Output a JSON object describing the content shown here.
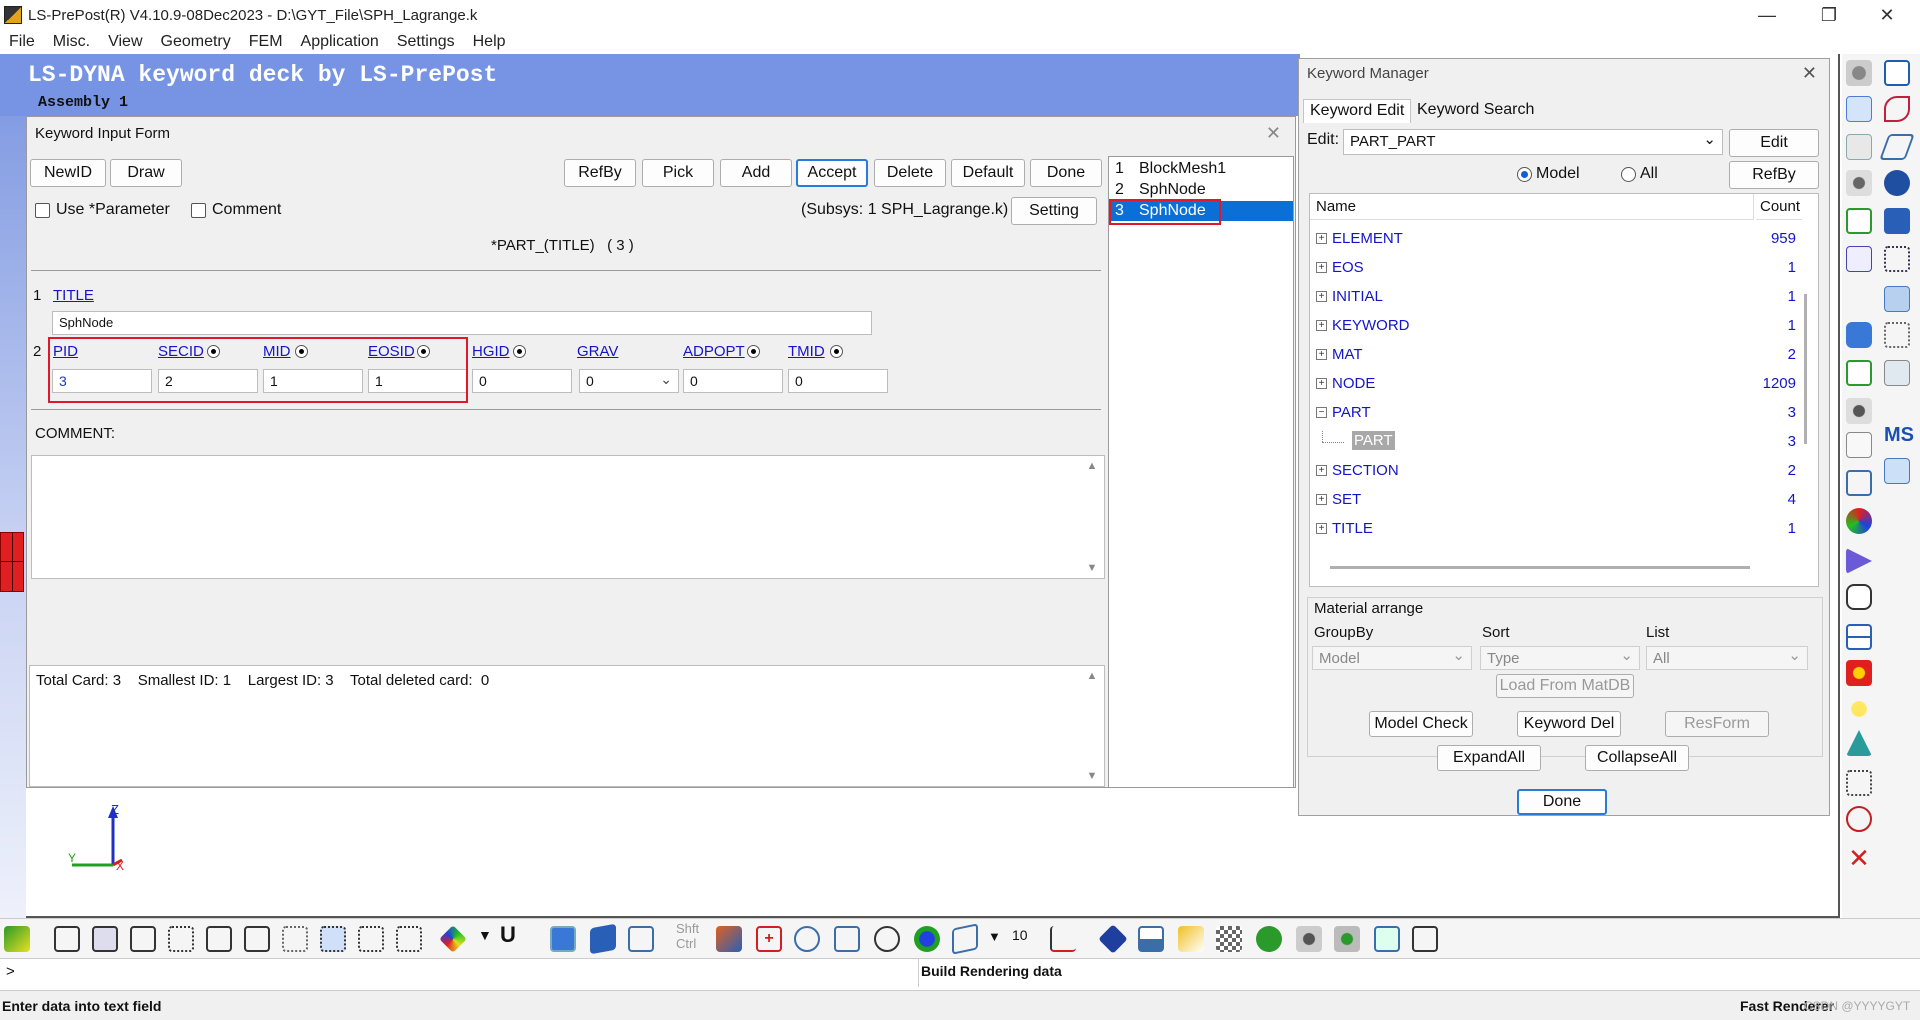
{
  "window": {
    "title": "LS-PrePost(R) V4.10.9-08Dec2023 - D:\\GYT_File\\SPH_Lagrange.k",
    "min": "—",
    "max": "❐",
    "close": "✕"
  },
  "menu": [
    "File",
    "Misc.",
    "View",
    "Geometry",
    "FEM",
    "Application",
    "Settings",
    "Help"
  ],
  "banner": {
    "title": "LS-DYNA keyword deck by LS-PrePost",
    "subtitle": "Assembly 1"
  },
  "kif": {
    "title": "Keyword Input Form",
    "close": "✕",
    "buttons": {
      "newid": "NewID",
      "draw": "Draw",
      "refby": "RefBy",
      "pick": "Pick",
      "add": "Add",
      "accept": "Accept",
      "delete": "Delete",
      "default": "Default",
      "done": "Done",
      "setting": "Setting"
    },
    "use_param": "Use *Parameter",
    "comment_chk": "Comment",
    "subsys": "(Subsys: 1 SPH_Lagrange.k)",
    "keyword": "*PART_(TITLE)   ( 3 )",
    "card1_num": "1",
    "title_label": "TITLE",
    "title_value": "SphNode",
    "card2_num": "2",
    "fields": [
      {
        "label": "PID",
        "value": "3",
        "dot": false
      },
      {
        "label": "SECID",
        "value": "2",
        "dot": true
      },
      {
        "label": "MID",
        "value": "1",
        "dot": true
      },
      {
        "label": "EOSID",
        "value": "1",
        "dot": true
      },
      {
        "label": "HGID",
        "value": "0",
        "dot": true
      },
      {
        "label": "GRAV",
        "value": "0",
        "dot": false
      },
      {
        "label": "ADPOPT",
        "value": "0",
        "dot": true
      },
      {
        "label": "TMID",
        "value": "0",
        "dot": true
      }
    ],
    "comment_label": "COMMENT:",
    "info": "Total Card: 3    Smallest ID: 1    Largest ID: 3    Total deleted card:  0",
    "list": [
      {
        "n": "1",
        "name": "BlockMesh1"
      },
      {
        "n": "2",
        "name": "SphNode"
      },
      {
        "n": "3",
        "name": "SphNode"
      }
    ]
  },
  "km": {
    "title": "Keyword Manager",
    "close": "✕",
    "tab_edit": "Keyword Edit",
    "tab_search": "Keyword Search",
    "edit_label": "Edit:",
    "edit_value": "PART_PART",
    "edit_btn": "Edit",
    "model": "Model",
    "all": "All",
    "refby": "RefBy",
    "col_name": "Name",
    "col_count": "Count",
    "rows": [
      {
        "pm": "+",
        "name": "ELEMENT",
        "count": "959"
      },
      {
        "pm": "+",
        "name": "EOS",
        "count": "1"
      },
      {
        "pm": "+",
        "name": "INITIAL",
        "count": "1"
      },
      {
        "pm": "+",
        "name": "KEYWORD",
        "count": "1"
      },
      {
        "pm": "+",
        "name": "MAT",
        "count": "2"
      },
      {
        "pm": "+",
        "name": "NODE",
        "count": "1209"
      },
      {
        "pm": "−",
        "name": "PART",
        "count": "3"
      },
      {
        "pm": "",
        "name": "PART",
        "count": "3"
      },
      {
        "pm": "+",
        "name": "SECTION",
        "count": "2"
      },
      {
        "pm": "+",
        "name": "SET",
        "count": "4"
      },
      {
        "pm": "+",
        "name": "TITLE",
        "count": "1"
      }
    ],
    "mat_arrange": "Material arrange",
    "groupby": "GroupBy",
    "sort": "Sort",
    "list": "List",
    "groupby_val": "Model",
    "sort_val": "Type",
    "list_val": "All",
    "load": "Load From MatDB",
    "model_check": "Model Check",
    "keyword_del": "Keyword Del",
    "resform": "ResForm",
    "expand": "ExpandAll",
    "collapse": "CollapseAll",
    "done": "Done"
  },
  "axes": {
    "z": "Z",
    "y": "Y",
    "x": "X"
  },
  "toolbar": {
    "shft": "Shft",
    "ctrl": "Ctrl",
    "ten": "10",
    "u": "U"
  },
  "cmd": {
    "prompt": ">",
    "render": "Build Rendering data"
  },
  "status": {
    "left": "Enter data into text field",
    "right": "Fast Renderer",
    "wm": "CSDN @YYYYGYT"
  }
}
